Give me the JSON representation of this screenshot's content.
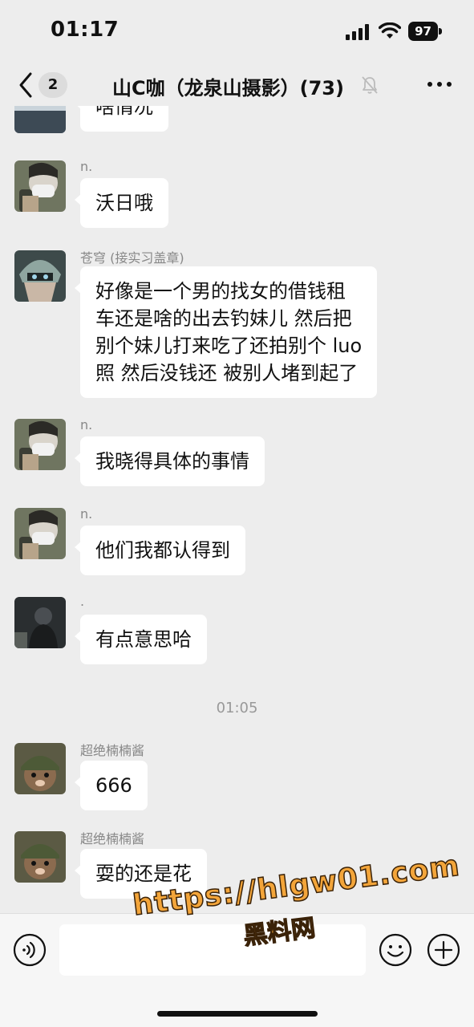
{
  "status_bar": {
    "time": "01:17",
    "battery": "97"
  },
  "nav": {
    "unread_count": "2",
    "title": "山C咖（龙泉山摄影）(73)"
  },
  "messages": [
    {
      "sender": "",
      "avatar": "avatar-landscape",
      "text": "啥情况"
    },
    {
      "sender": "n.",
      "avatar": "avatar-mask-person",
      "text": "沃日哦"
    },
    {
      "sender": "苍穹 (接实习盖章)",
      "avatar": "avatar-anime-helmet",
      "lines": [
        "好像是一个男的找女的借钱租",
        "车还是啥的出去钓妹儿  然后把",
        "别个妹儿打来吃了还拍别个 luo",
        "照 然后没钱还 被别人堵到起了"
      ]
    },
    {
      "sender": "n.",
      "avatar": "avatar-mask-person",
      "text": "我晓得具体的事情"
    },
    {
      "sender": "n.",
      "avatar": "avatar-mask-person",
      "text": "他们我都认得到"
    },
    {
      "sender": ".",
      "avatar": "avatar-dark-figure",
      "text": "有点意思哈"
    },
    {
      "divider": "01:05"
    },
    {
      "sender": "超绝楠楠酱",
      "avatar": "avatar-helmet-mole",
      "text": "666"
    },
    {
      "sender": "超绝楠楠酱",
      "avatar": "avatar-helmet-mole",
      "text": "耍的还是花"
    }
  ],
  "watermark": {
    "url": "https://hlgw01.com",
    "name": "黑料网"
  },
  "colors": {
    "background": "#ededed",
    "bubble": "#ffffff",
    "watermark": "#f3a53a"
  }
}
